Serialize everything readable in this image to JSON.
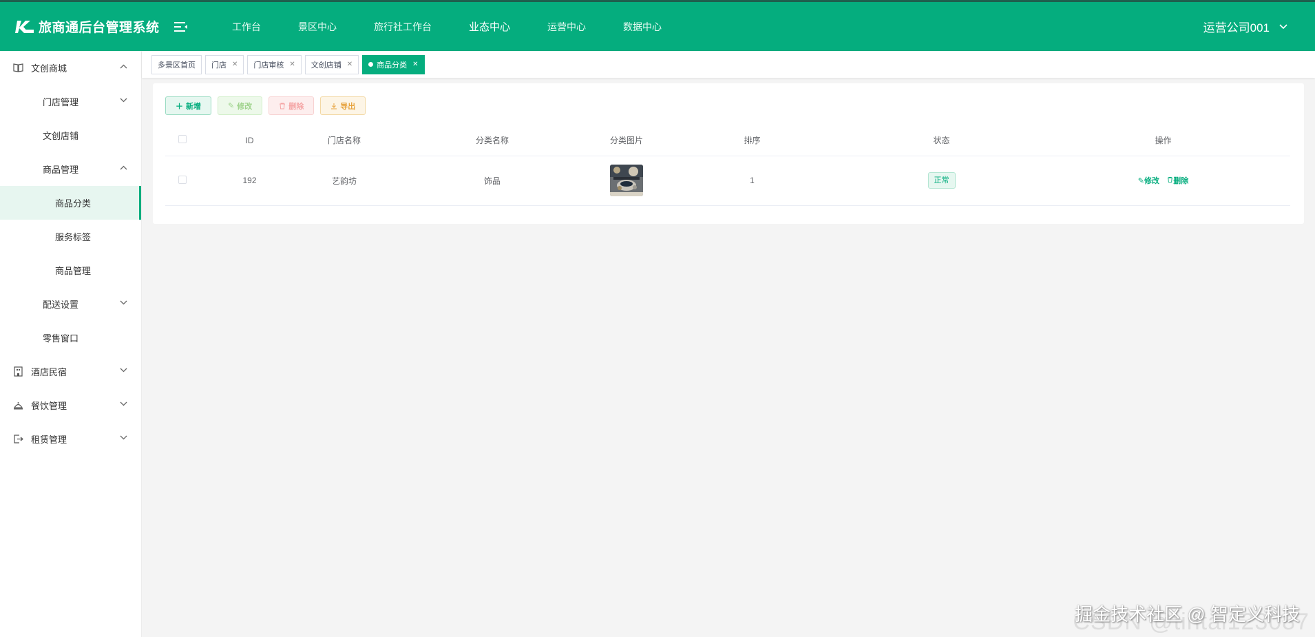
{
  "header": {
    "title": "旅商通后台管理系统",
    "nav": [
      "工作台",
      "景区中心",
      "旅行社工作台",
      "业态中心",
      "运营中心",
      "数据中心"
    ],
    "active_nav": "业态中心",
    "user": "运营公司001"
  },
  "sidebar": {
    "items": [
      {
        "label": "文创商城",
        "icon": "book-icon"
      },
      {
        "label": "门店管理"
      },
      {
        "label": "文创店铺"
      },
      {
        "label": "商品管理"
      },
      {
        "label": "商品分类"
      },
      {
        "label": "服务标签"
      },
      {
        "label": "商品管理"
      },
      {
        "label": "配送设置"
      },
      {
        "label": "零售窗口"
      },
      {
        "label": "酒店民宿",
        "icon": "building-icon"
      },
      {
        "label": "餐饮管理",
        "icon": "dining-icon"
      },
      {
        "label": "租赁管理",
        "icon": "exit-icon"
      }
    ]
  },
  "tags": [
    {
      "label": "多景区首页"
    },
    {
      "label": "门店"
    },
    {
      "label": "门店审核"
    },
    {
      "label": "文创店铺"
    },
    {
      "label": "商品分类"
    }
  ],
  "toolbar": {
    "add": "新增",
    "edit": "修改",
    "delete": "删除",
    "export": "导出"
  },
  "table": {
    "columns": [
      "ID",
      "门店名称",
      "分类名称",
      "分类图片",
      "排序",
      "状态",
      "操作"
    ],
    "rows": [
      {
        "id": "192",
        "store": "艺韵坊",
        "category": "饰品",
        "sort": "1",
        "status": "正常",
        "edit": "修改",
        "delete": "删除"
      }
    ]
  },
  "watermark": {
    "text": "掘金技术社区 @ 智定义科技",
    "ghost": "CSDN @tintai123087"
  },
  "colors": {
    "primary": "#05ad7e",
    "header_bg": "#05ad7e"
  }
}
